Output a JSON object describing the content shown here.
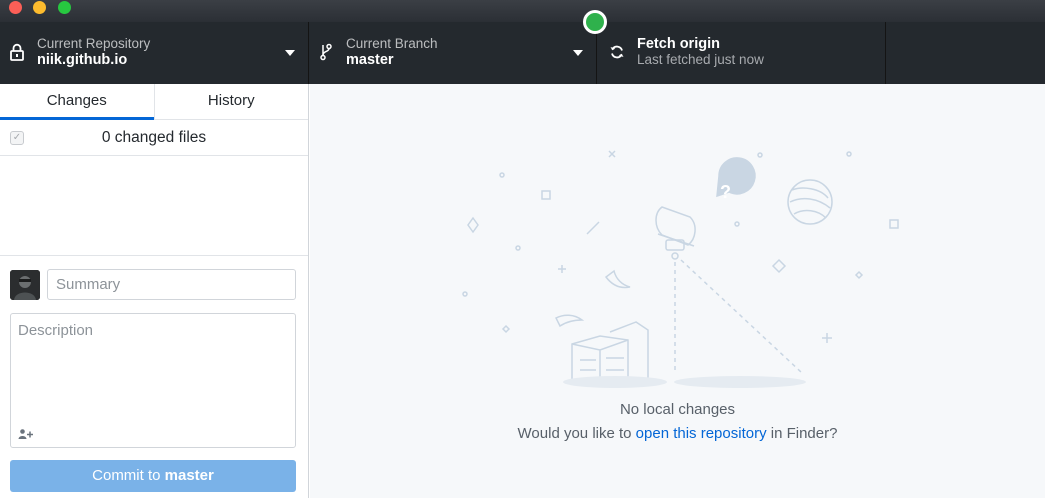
{
  "window": {
    "traffic_lights": [
      "close",
      "minimize",
      "maximize"
    ]
  },
  "toolbar": {
    "repository": {
      "label": "Current Repository",
      "value": "niik.github.io",
      "icon": "lock-icon"
    },
    "branch": {
      "label": "Current Branch",
      "value": "master",
      "icon": "git-branch-icon"
    },
    "fetch": {
      "label": "Fetch origin",
      "status": "Last fetched just now",
      "icon": "sync-icon"
    }
  },
  "sidebar": {
    "tabs": [
      {
        "label": "Changes",
        "selected": true
      },
      {
        "label": "History",
        "selected": false
      }
    ],
    "changes_header": {
      "count_text": "0 changed files",
      "checked": true
    },
    "commit": {
      "summary_placeholder": "Summary",
      "description_placeholder": "Description",
      "button_prefix": "Commit to ",
      "button_branch": "master"
    }
  },
  "main": {
    "blank_title": "No local changes",
    "blank_prefix": "Would you like to ",
    "blank_link": "open this repository",
    "blank_suffix": " in Finder?"
  },
  "colors": {
    "toolbar_bg": "#24292e",
    "accent": "#0366d6",
    "commit_button": "#7ab2e8",
    "status_dot": "#2fb14c",
    "main_bg": "#f6f8fa"
  }
}
